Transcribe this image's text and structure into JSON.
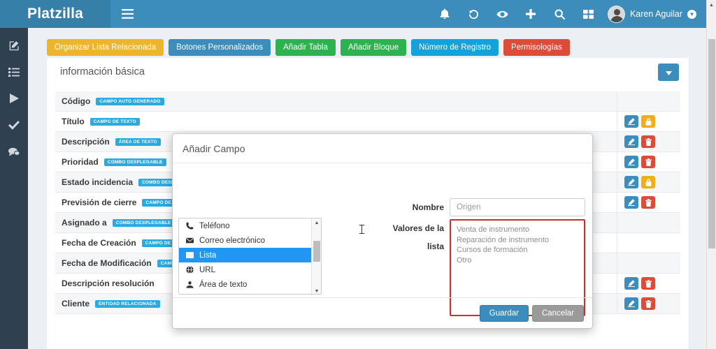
{
  "topbar": {
    "brand": "Platzilla",
    "menu_icon": "hamburger-icon",
    "icons": [
      "bell-icon",
      "history-icon",
      "eye-icon",
      "plus-icon",
      "search-icon",
      "grid-icon"
    ],
    "user_name": "Karen Aguilar",
    "bg_color": "#3c8dbc",
    "brand_bg_color": "#367fa9"
  },
  "sidebar": {
    "bg_color": "#2f4050",
    "items": [
      {
        "icon": "edit-square-icon",
        "name": "sidebar-item-edit"
      },
      {
        "icon": "list-icon",
        "name": "sidebar-item-list"
      },
      {
        "icon": "play-icon",
        "name": "sidebar-item-play"
      },
      {
        "icon": "check-icon",
        "name": "sidebar-item-check"
      },
      {
        "icon": "comment-icon",
        "name": "sidebar-item-comment"
      }
    ]
  },
  "toolbar": {
    "buttons": [
      {
        "label": "Organizar Lista Relacionada",
        "color": "#ecb52c"
      },
      {
        "label": "Botones Personalizados",
        "color": "#3c8dbc"
      },
      {
        "label": "Añadir Tabla",
        "color": "#2eb14f"
      },
      {
        "label": "Añadir Bloque",
        "color": "#2eb14f"
      },
      {
        "label": "Número de Registro",
        "color": "#14a2dc"
      },
      {
        "label": "Permisologías",
        "color": "#dd4b39"
      }
    ]
  },
  "panel": {
    "title": "información básica",
    "collapse_icon": "chevron-down-icon",
    "collapse_color": "#3c8dbc"
  },
  "table": {
    "rows": [
      {
        "name": "Código",
        "badge": "CAMPO AUTO GENERADO",
        "actions": []
      },
      {
        "name": "Título",
        "badge": "CAMPO DE TEXTO",
        "actions": [
          "edit",
          "lock"
        ]
      },
      {
        "name": "Descripción",
        "badge": "ÁREA DE TEXTO",
        "actions": [
          "edit",
          "del"
        ]
      },
      {
        "name": "Prioridad",
        "badge": "COMBO DESPLEGABLE",
        "actions": [
          "edit",
          "del"
        ]
      },
      {
        "name": "Estado incidencia",
        "badge": "COMBO DESPLEGABLE",
        "actions": [
          "edit",
          "lock"
        ]
      },
      {
        "name": "Previsión de cierre",
        "badge": "CAMPO DE FECHA",
        "actions": [
          "edit",
          "del"
        ]
      },
      {
        "name": "Asignado a",
        "badge": "COMBO DESPLEGABLE",
        "actions": []
      },
      {
        "name": "Fecha de Creación",
        "badge": "CAMPO DE FECHA",
        "actions": []
      },
      {
        "name": "Fecha de Modificación",
        "badge": "CAMPO DE FECHA",
        "actions": []
      },
      {
        "name": "Descripción resolución",
        "badge": "",
        "actions": [
          "edit",
          "del"
        ]
      },
      {
        "name": "Cliente",
        "badge": "ENTIDAD RELACIONADA",
        "actions": [
          "edit",
          "del"
        ]
      }
    ],
    "badge_color": "#29abe2"
  },
  "modal": {
    "title": "Añadir Campo",
    "type_list": [
      {
        "label": "Teléfono",
        "icon": "phone-icon",
        "selected": false
      },
      {
        "label": "Correo electrónico",
        "icon": "envelope-icon",
        "selected": false
      },
      {
        "label": "Lista",
        "icon": "list-box-icon",
        "selected": true
      },
      {
        "label": "URL",
        "icon": "globe-icon",
        "selected": false
      },
      {
        "label": "Área de texto",
        "icon": "textarea-icon",
        "selected": false
      }
    ],
    "name_label": "Nombre",
    "name_value": "Origen",
    "name_placeholder": "Origen",
    "list_values_label": "Valores de la lista",
    "list_values": "Venta de instrumento\nReparación de instrumento\nCursos de formación\nOtro",
    "list_values_border_color": "#c9302c",
    "save_label": "Guardar",
    "cancel_label": "Cancelar",
    "save_color": "#3c8dbc",
    "cancel_color": "#9a9a9a"
  }
}
